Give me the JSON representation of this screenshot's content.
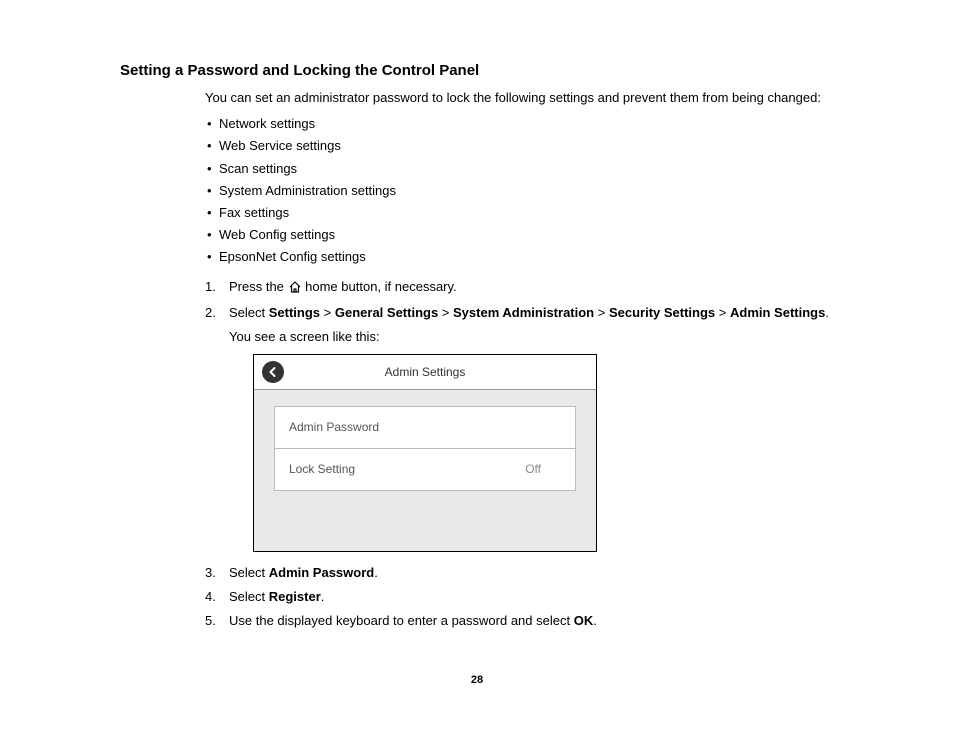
{
  "heading": "Setting a Password and Locking the Control Panel",
  "intro": "You can set an administrator password to lock the following settings and prevent them from being changed:",
  "bullets": [
    "Network settings",
    "Web Service settings",
    "Scan settings",
    "System Administration settings",
    "Fax settings",
    "Web Config settings",
    "EpsonNet Config settings"
  ],
  "step1_before": "Press the ",
  "step1_after": " home button, if necessary.",
  "step2": {
    "prefix": "Select ",
    "p1": "Settings",
    "sep": " > ",
    "p2": "General Settings",
    "p3": "System Administration",
    "p4": "Security Settings",
    "p5": "Admin Settings",
    "suffix": "."
  },
  "step2_sub": "You see a screen like this:",
  "screen": {
    "title": "Admin Settings",
    "row1": "Admin Password",
    "row2_label": "Lock Setting",
    "row2_value": "Off"
  },
  "step3_a": "Select ",
  "step3_b": "Admin Password",
  "step3_c": ".",
  "step4_a": "Select ",
  "step4_b": "Register",
  "step4_c": ".",
  "step5_a": "Use the displayed keyboard to enter a password and select ",
  "step5_b": "OK",
  "step5_c": ".",
  "page_number": "28"
}
